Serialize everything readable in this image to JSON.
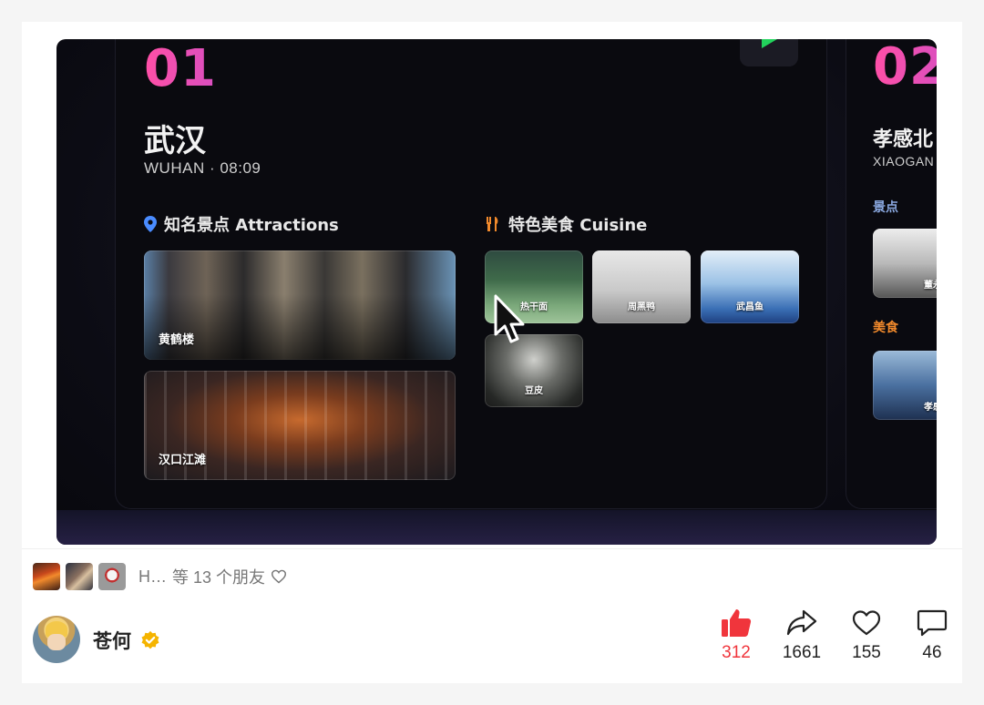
{
  "slide1": {
    "number": "01",
    "city": "武汉",
    "subtitle": "WUHAN · 08:09",
    "attractions_title": "知名景点 Attractions",
    "cuisine_title": "特色美食 Cuisine",
    "attractions": [
      "黄鹤楼",
      "汉口江滩"
    ],
    "cuisine": [
      "热干面",
      "周黑鸭",
      "武昌鱼",
      "豆皮"
    ]
  },
  "slide2": {
    "number": "02",
    "city": "孝感北",
    "subtitle": "XIAOGAN",
    "attractions_label": "景点",
    "cuisine_label": "美食",
    "attraction_tile": "董永",
    "cuisine_tile": "孝感"
  },
  "friends": {
    "name": "H…",
    "text": "等 13 个朋友"
  },
  "author": {
    "name": "苍何"
  },
  "stats": {
    "likes": "312",
    "shares": "1661",
    "favorites": "155",
    "comments": "46"
  },
  "colors": {
    "accent_pink": "#ff4fa6",
    "like_red": "#f0353c",
    "verified_gold": "#f5b400"
  }
}
